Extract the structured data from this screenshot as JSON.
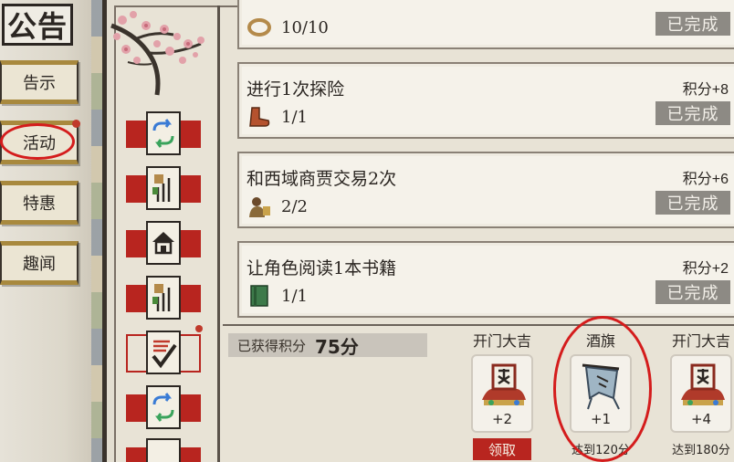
{
  "sidebar": {
    "title": "公告",
    "items": [
      {
        "label": "告示"
      },
      {
        "label": "活动"
      },
      {
        "label": "特惠"
      },
      {
        "label": "趣闻"
      }
    ]
  },
  "quests": [
    {
      "title": "",
      "progress": "10/10",
      "points": "",
      "status": "已完成",
      "icon": "rope-icon"
    },
    {
      "title": "进行1次探险",
      "progress": "1/1",
      "points": "积分+8",
      "status": "已完成",
      "icon": "boot-icon"
    },
    {
      "title": "和西域商贾交易2次",
      "progress": "2/2",
      "points": "积分+6",
      "status": "已完成",
      "icon": "merchant-icon"
    },
    {
      "title": "让角色阅读1本书籍",
      "progress": "1/1",
      "points": "积分+2",
      "status": "已完成",
      "icon": "book-icon"
    }
  ],
  "score": {
    "label": "已获得积分",
    "value": "75分"
  },
  "rewards": [
    {
      "name": "开门大吉",
      "count": "+2",
      "button": "领取"
    },
    {
      "name": "酒旗",
      "count": "+1",
      "note": "达到120分"
    },
    {
      "name": "开门大吉",
      "count": "+4",
      "note": "达到180分"
    }
  ],
  "colors": {
    "accent_red": "#b8251f",
    "done_gray": "#8d8a84",
    "annotation": "#d41c1c"
  }
}
